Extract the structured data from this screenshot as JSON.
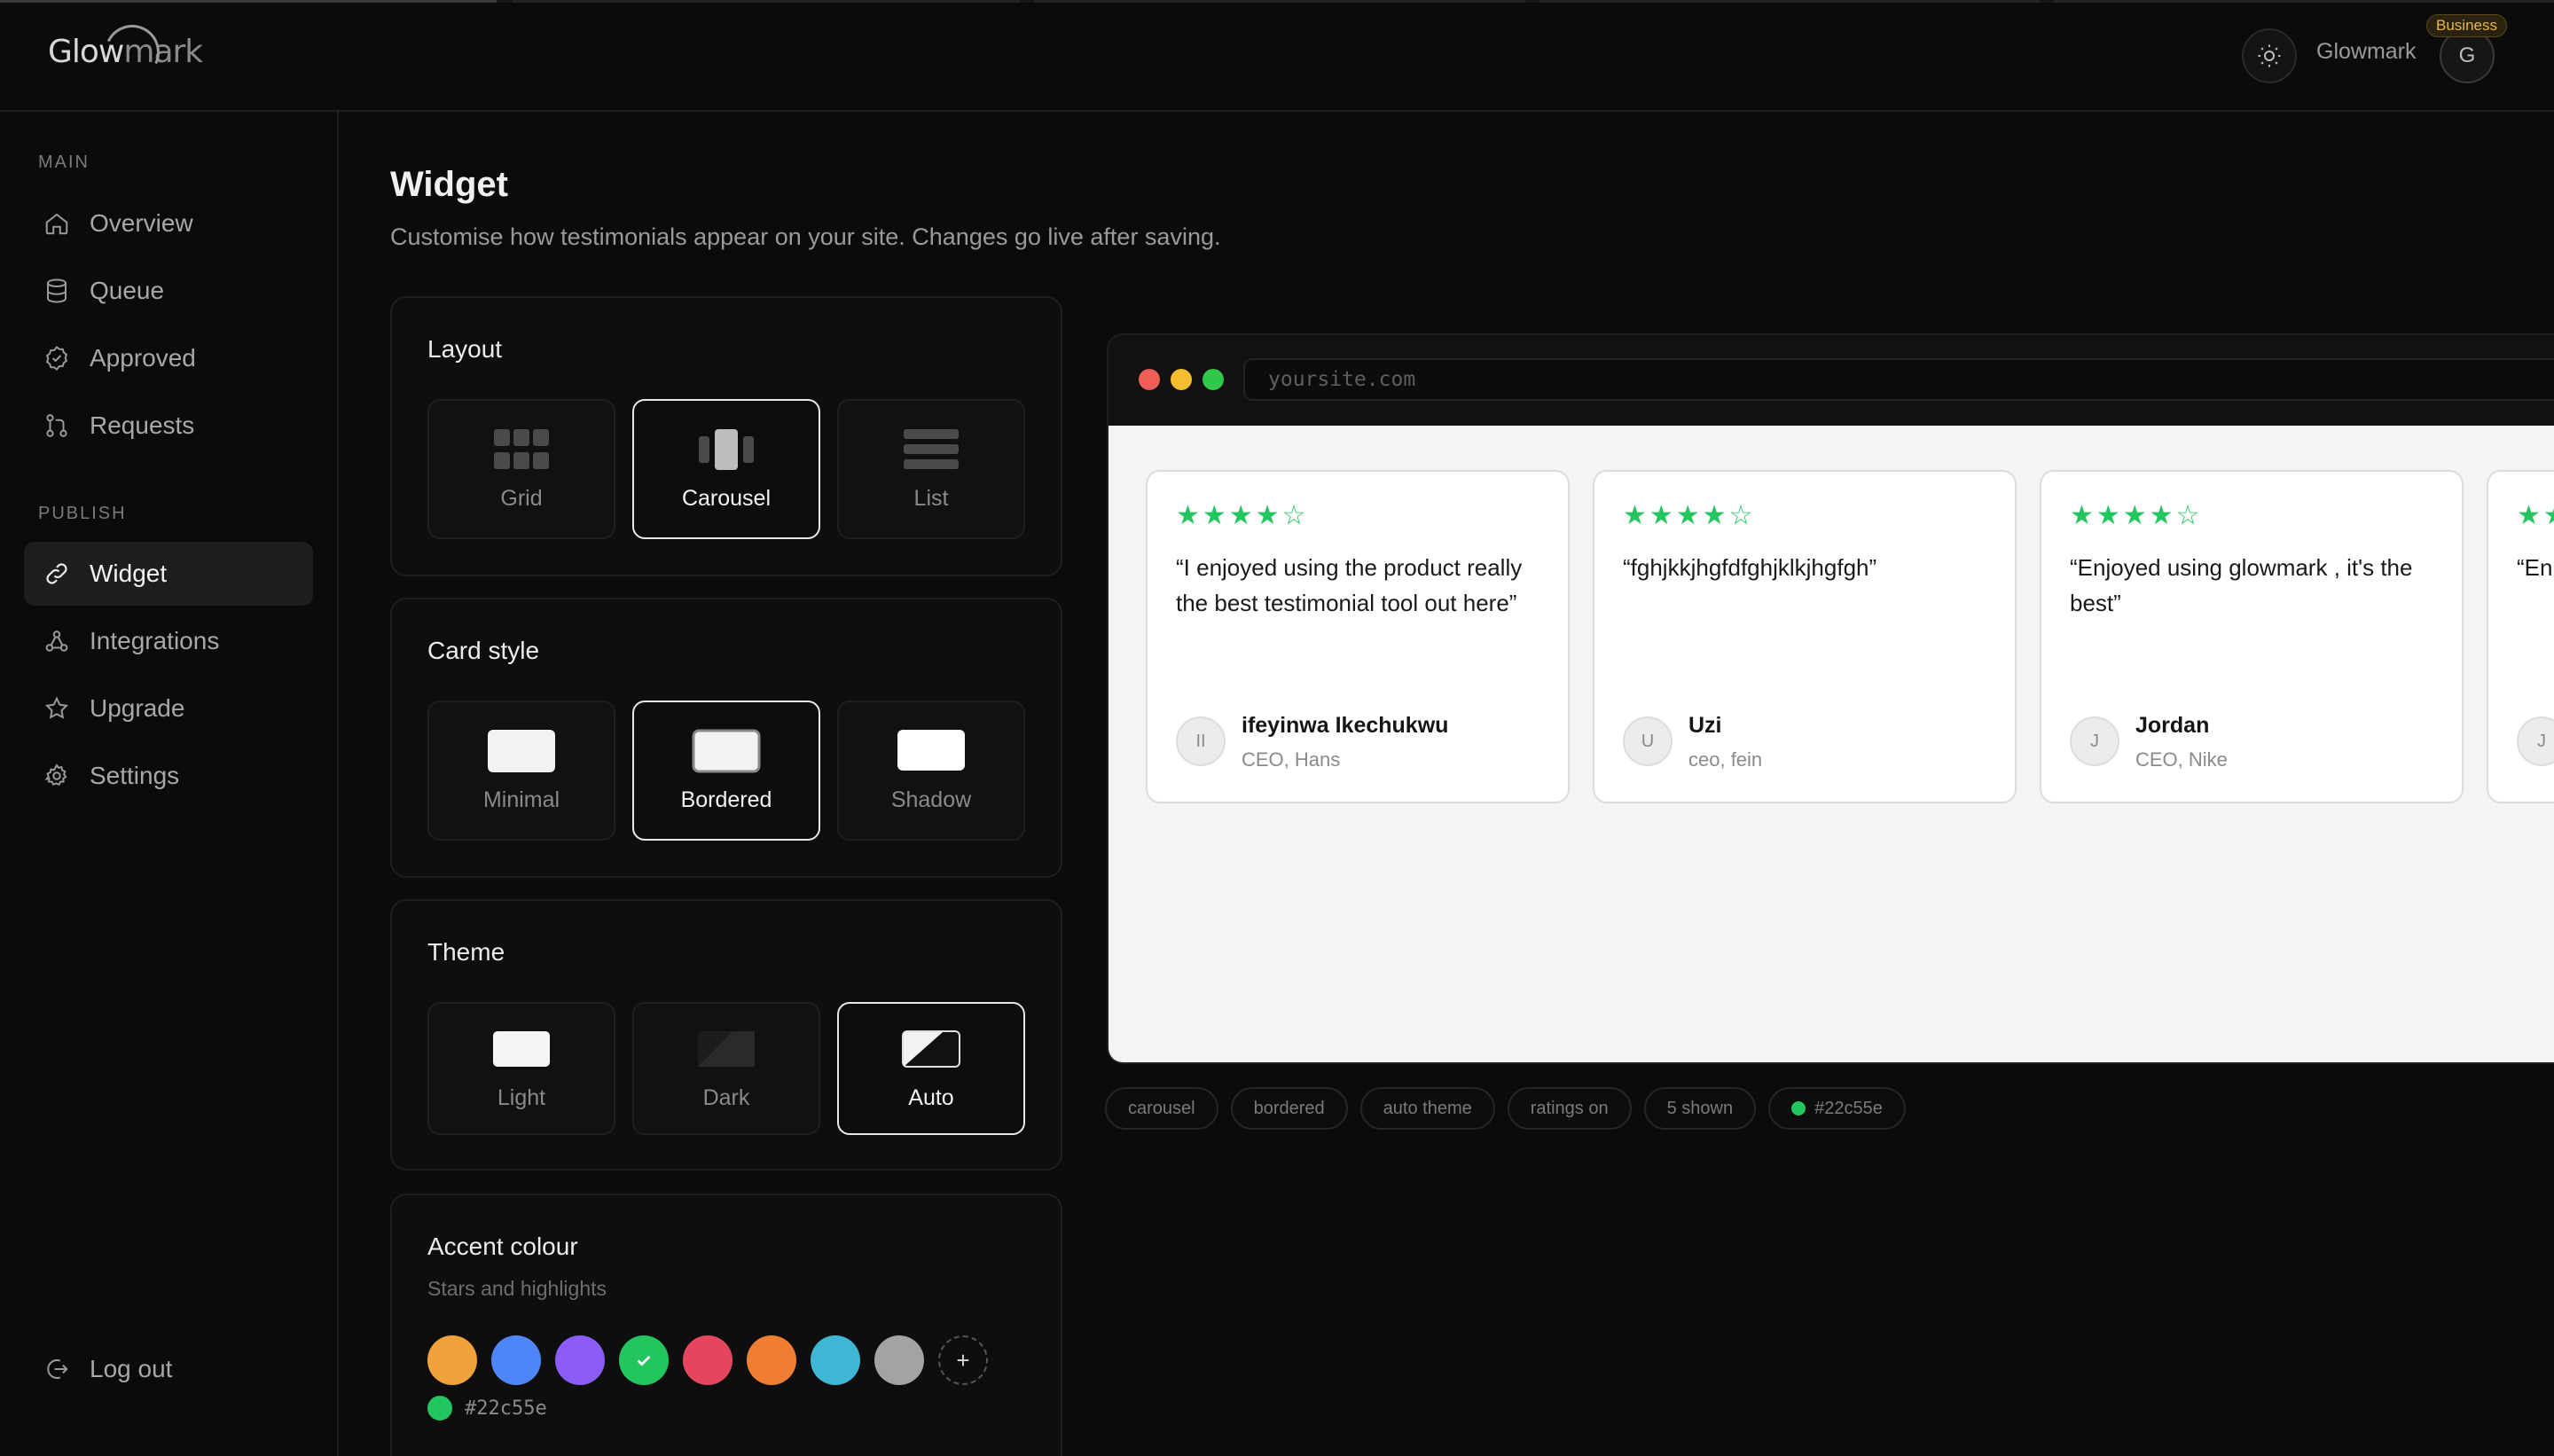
{
  "brand": {
    "logo_a": "Glow",
    "logo_b": "mark",
    "name": "Glowmark",
    "plan": "Business",
    "avatar_initial": "G"
  },
  "sidebar": {
    "main_label": "MAIN",
    "publish_label": "PUBLISH",
    "main_items": [
      {
        "label": "Overview",
        "icon": "home-icon"
      },
      {
        "label": "Queue",
        "icon": "database-icon"
      },
      {
        "label": "Approved",
        "icon": "check-badge-icon"
      },
      {
        "label": "Requests",
        "icon": "git-pull-icon"
      }
    ],
    "publish_items": [
      {
        "label": "Widget",
        "icon": "link-icon",
        "active": true
      },
      {
        "label": "Integrations",
        "icon": "integrations-icon"
      },
      {
        "label": "Upgrade",
        "icon": "star-icon"
      },
      {
        "label": "Settings",
        "icon": "gear-icon"
      }
    ],
    "logout": "Log out"
  },
  "page": {
    "title": "Widget",
    "subtitle": "Customise how testimonials appear on your site. Changes go live after saving."
  },
  "layout_panel": {
    "title": "Layout",
    "options": [
      "Grid",
      "Carousel",
      "List"
    ],
    "selected": "Carousel"
  },
  "card_style_panel": {
    "title": "Card style",
    "options": [
      "Minimal",
      "Bordered",
      "Shadow"
    ],
    "selected": "Bordered"
  },
  "theme_panel": {
    "title": "Theme",
    "options": [
      "Light",
      "Dark",
      "Auto"
    ],
    "selected": "Auto"
  },
  "accent_panel": {
    "title": "Accent colour",
    "subtitle": "Stars and highlights",
    "swatches": [
      "#f0a23a",
      "#4f86f7",
      "#8b5cf6",
      "#22c55e",
      "#e5465e",
      "#ef7d32",
      "#3fb6d3",
      "#a3a3a3"
    ],
    "selected": "#22c55e",
    "add_label": "+",
    "hex_value": "#22c55e"
  },
  "preview": {
    "url_placeholder": "yoursite.com",
    "traffic_colors": [
      "#ef5f57",
      "#f5be31",
      "#2fc84a"
    ],
    "testimonials": [
      {
        "stars": "★★★★☆",
        "quote": "“I enjoyed using the product really the best testimonial tool out here”",
        "initials": "II",
        "name": "ifeyinwa Ikechukwu",
        "role": "CEO, Hans"
      },
      {
        "stars": "★★★★☆",
        "quote": "“fghjkkjhgfdfghjklkjhgfgh”",
        "initials": "U",
        "name": "Uzi",
        "role": "ceo, fein"
      },
      {
        "stars": "★★★★☆",
        "quote": "“Enjoyed using glowmark , it's the best”",
        "initials": "J",
        "name": "Jordan",
        "role": "CEO, Nike"
      },
      {
        "stars": "★★★★☆",
        "quote": "“En",
        "initials": "J",
        "name": "",
        "role": ""
      }
    ]
  },
  "chips": [
    "carousel",
    "bordered",
    "auto theme",
    "ratings on",
    "5 shown",
    "#22c55e"
  ]
}
